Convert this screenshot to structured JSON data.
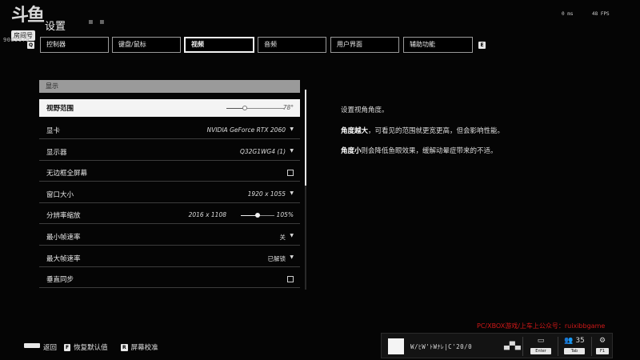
{
  "watermark": {
    "glyph": "斗鱼",
    "room_label": "房间号",
    "room_id": "9065970"
  },
  "header": {
    "title": "设置",
    "ping": "0 ms",
    "fps": "48 FPS"
  },
  "tabs": {
    "prev_key": "Q",
    "next_key": "E",
    "items": [
      {
        "label": "控制器"
      },
      {
        "label": "键盘/鼠标"
      },
      {
        "label": "视频"
      },
      {
        "label": "音频"
      },
      {
        "label": "用户界面"
      },
      {
        "label": "辅助功能"
      }
    ]
  },
  "section": {
    "title": "显示"
  },
  "settings": [
    {
      "label": "视野范围",
      "value": "78°",
      "slider": 0.32
    },
    {
      "label": "显卡",
      "value": "NVIDIA GeForce RTX 2060"
    },
    {
      "label": "显示器",
      "value": "Q32G1WG4 (1)"
    },
    {
      "label": "无边框全屏幕",
      "checked": false
    },
    {
      "label": "窗口大小",
      "value": "1920 x 1055"
    },
    {
      "label": "分辨率缩放",
      "value": "105%",
      "sub_value": "2016 x 1108",
      "slider": 0.5
    },
    {
      "label": "最小帧速率",
      "value": "关"
    },
    {
      "label": "最大帧速率",
      "value": "已解锁"
    },
    {
      "label": "垂直同步",
      "checked": false
    }
  ],
  "description": {
    "line1": "设置视角角度。",
    "line2_bold": "角度越大",
    "line2_rest": "，可看见的范围就更宽更高，但会影响性能。",
    "line3_bold": "角度小",
    "line3_rest": "则会降低鱼眼效果，缓解动晕症带来的不适。"
  },
  "hints": [
    {
      "key": "",
      "label": "返回"
    },
    {
      "key": "F",
      "label": "恢复默认值"
    },
    {
      "key": "R",
      "label": "屏幕校准"
    }
  ],
  "promo": "PC/XBOX游戏/上车上公众号：ruixibbgame",
  "player": {
    "name": "W/ﾋW'ﾄWﾅﾚ|C'20/0",
    "pad_icon": "gamepad-icon",
    "chat_key": "Enter",
    "friends_count": "35",
    "friends_key": "Tab",
    "settings_key": "F1"
  }
}
